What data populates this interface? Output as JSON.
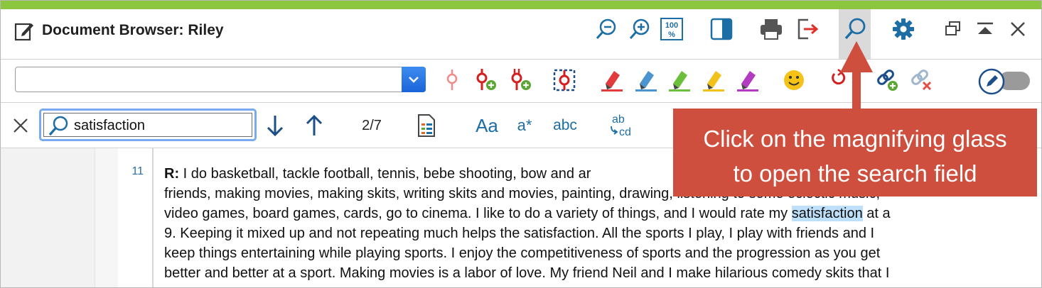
{
  "window": {
    "title": "Document Browser: Riley",
    "accent_color": "#8cc63f"
  },
  "titlebar_icons": [
    "document-edit-icon",
    "zoom-out-icon",
    "zoom-in-icon",
    "zoom-100-icon",
    "panel-toggle-icon",
    "print-icon",
    "export-icon",
    "search-icon",
    "settings-gear-icon",
    "restore-window-icon",
    "collapse-icon",
    "close-icon"
  ],
  "zoom_100_label": "100",
  "toolbar": {
    "document_select_value": "",
    "icons": [
      "code-pin-icon",
      "code-pin-add-icon",
      "code-pin-add-multiple-icon",
      "selection-code-icon",
      "highlight-red-icon",
      "highlight-blue-icon",
      "highlight-green-icon",
      "highlight-yellow-icon",
      "highlight-purple-icon",
      "emoticon-icon",
      "link-rotate-icon",
      "link-add-icon",
      "link-remove-icon",
      "edit-mode-icon",
      "edit-mode-toggle"
    ]
  },
  "search": {
    "query": "satisfaction",
    "result_position": "2/7",
    "options": {
      "match_case": "Aa",
      "wildcard": "a*",
      "whole_word": "abc",
      "replace": [
        "ab",
        "cd"
      ]
    }
  },
  "content": {
    "line_number": "11",
    "speaker": "R:",
    "lines": [
      {
        "text": " I do basketball, tackle football, tennis, bebe shooting, bow and ar"
      },
      {
        "text": "friends, making movies, making skits, writing skits and movies, painting, drawing, listening to some eclectic music,"
      },
      {
        "before": "video games, board games, cards, go to cinema. I like to do a variety of things, and I would rate my ",
        "highlight": "satisfaction",
        "after": " at a"
      },
      {
        "text": "9. Keeping it mixed up and not repeating much helps the satisfaction. All the sports I play, I play with friends and I"
      },
      {
        "text": "keep things entertaining while playing sports. I enjoy the competitiveness of sports and the progression as you get"
      },
      {
        "text": "better and better at a sport. Making movies is a labor of love. My friend Neil and I make hilarious comedy skits that I"
      }
    ]
  },
  "callout": {
    "line1": "Click on the magnifying glass",
    "line2": "to open the search field",
    "color": "#cf4f3f"
  }
}
